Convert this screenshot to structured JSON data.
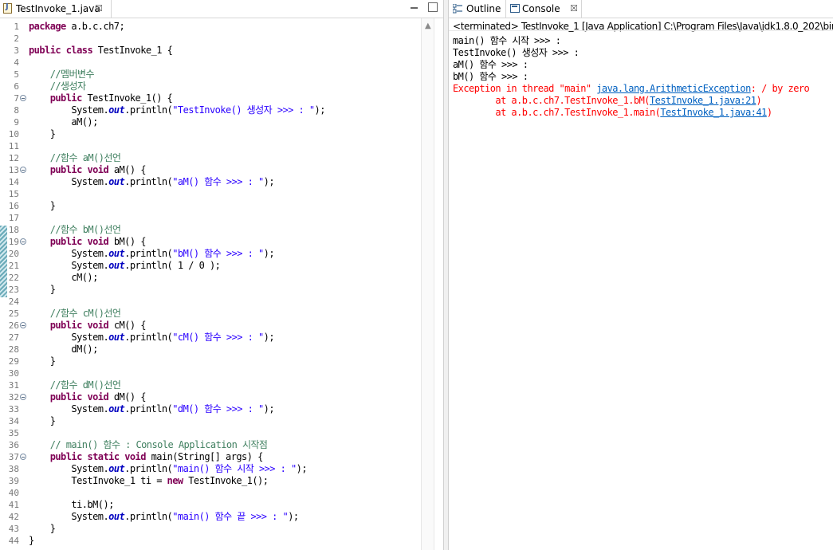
{
  "editor": {
    "tab_title": "TestInvoke_1.java",
    "tab_close": "☒",
    "file_icon_letter": "J",
    "lines": [
      {
        "n": "1",
        "fold": false,
        "segs": [
          {
            "c": "kw",
            "t": "package"
          },
          {
            "c": "",
            "t": " a.b.c.ch7;"
          }
        ]
      },
      {
        "n": "2",
        "fold": false,
        "segs": []
      },
      {
        "n": "3",
        "fold": false,
        "segs": [
          {
            "c": "kw",
            "t": "public"
          },
          {
            "c": "",
            "t": " "
          },
          {
            "c": "kw",
            "t": "class"
          },
          {
            "c": "",
            "t": " TestInvoke_1 {"
          }
        ]
      },
      {
        "n": "4",
        "fold": false,
        "segs": []
      },
      {
        "n": "5",
        "fold": false,
        "segs": [
          {
            "c": "",
            "t": "    "
          },
          {
            "c": "cm",
            "t": "//멤버변수"
          }
        ]
      },
      {
        "n": "6",
        "fold": false,
        "segs": [
          {
            "c": "",
            "t": "    "
          },
          {
            "c": "cm",
            "t": "//생성자"
          }
        ]
      },
      {
        "n": "7",
        "fold": true,
        "segs": [
          {
            "c": "",
            "t": "    "
          },
          {
            "c": "kw",
            "t": "public"
          },
          {
            "c": "",
            "t": " TestInvoke_1() {"
          }
        ]
      },
      {
        "n": "8",
        "fold": false,
        "segs": [
          {
            "c": "",
            "t": "        System."
          },
          {
            "c": "fld",
            "t": "out"
          },
          {
            "c": "",
            "t": ".println("
          },
          {
            "c": "str",
            "t": "\"TestInvoke() 생성자 >>> : \""
          },
          {
            "c": "",
            "t": ");"
          }
        ]
      },
      {
        "n": "9",
        "fold": false,
        "segs": [
          {
            "c": "",
            "t": "        aM();"
          }
        ]
      },
      {
        "n": "10",
        "fold": false,
        "segs": [
          {
            "c": "",
            "t": "    }"
          }
        ]
      },
      {
        "n": "11",
        "fold": false,
        "segs": []
      },
      {
        "n": "12",
        "fold": false,
        "segs": [
          {
            "c": "",
            "t": "    "
          },
          {
            "c": "cm",
            "t": "//함수 aM()선언"
          }
        ]
      },
      {
        "n": "13",
        "fold": true,
        "segs": [
          {
            "c": "",
            "t": "    "
          },
          {
            "c": "kw",
            "t": "public"
          },
          {
            "c": "",
            "t": " "
          },
          {
            "c": "kw",
            "t": "void"
          },
          {
            "c": "",
            "t": " aM() {"
          }
        ]
      },
      {
        "n": "14",
        "fold": false,
        "segs": [
          {
            "c": "",
            "t": "        System."
          },
          {
            "c": "fld",
            "t": "out"
          },
          {
            "c": "",
            "t": ".println("
          },
          {
            "c": "str",
            "t": "\"aM() 함수 >>> : \""
          },
          {
            "c": "",
            "t": ");"
          }
        ]
      },
      {
        "n": "15",
        "fold": false,
        "segs": []
      },
      {
        "n": "16",
        "fold": false,
        "segs": [
          {
            "c": "",
            "t": "    }"
          }
        ]
      },
      {
        "n": "17",
        "fold": false,
        "segs": []
      },
      {
        "n": "18",
        "fold": false,
        "segs": [
          {
            "c": "",
            "t": "    "
          },
          {
            "c": "cm",
            "t": "//함수 bM()선언"
          }
        ]
      },
      {
        "n": "19",
        "fold": true,
        "segs": [
          {
            "c": "",
            "t": "    "
          },
          {
            "c": "kw",
            "t": "public"
          },
          {
            "c": "",
            "t": " "
          },
          {
            "c": "kw",
            "t": "void"
          },
          {
            "c": "",
            "t": " bM() {"
          }
        ]
      },
      {
        "n": "20",
        "fold": false,
        "segs": [
          {
            "c": "",
            "t": "        System."
          },
          {
            "c": "fld",
            "t": "out"
          },
          {
            "c": "",
            "t": ".println("
          },
          {
            "c": "str",
            "t": "\"bM() 함수 >>> : \""
          },
          {
            "c": "",
            "t": ");"
          }
        ]
      },
      {
        "n": "21",
        "fold": false,
        "segs": [
          {
            "c": "",
            "t": "        System."
          },
          {
            "c": "fld",
            "t": "out"
          },
          {
            "c": "",
            "t": ".println( 1 / 0 );"
          }
        ]
      },
      {
        "n": "22",
        "fold": false,
        "segs": [
          {
            "c": "",
            "t": "        cM();"
          }
        ]
      },
      {
        "n": "23",
        "fold": false,
        "segs": [
          {
            "c": "",
            "t": "    }"
          }
        ]
      },
      {
        "n": "24",
        "fold": false,
        "segs": []
      },
      {
        "n": "25",
        "fold": false,
        "segs": [
          {
            "c": "",
            "t": "    "
          },
          {
            "c": "cm",
            "t": "//함수 cM()선언"
          }
        ]
      },
      {
        "n": "26",
        "fold": true,
        "segs": [
          {
            "c": "",
            "t": "    "
          },
          {
            "c": "kw",
            "t": "public"
          },
          {
            "c": "",
            "t": " "
          },
          {
            "c": "kw",
            "t": "void"
          },
          {
            "c": "",
            "t": " cM() {"
          }
        ]
      },
      {
        "n": "27",
        "fold": false,
        "segs": [
          {
            "c": "",
            "t": "        System."
          },
          {
            "c": "fld",
            "t": "out"
          },
          {
            "c": "",
            "t": ".println("
          },
          {
            "c": "str",
            "t": "\"cM() 함수 >>> : \""
          },
          {
            "c": "",
            "t": ");"
          }
        ]
      },
      {
        "n": "28",
        "fold": false,
        "segs": [
          {
            "c": "",
            "t": "        dM();"
          }
        ]
      },
      {
        "n": "29",
        "fold": false,
        "segs": [
          {
            "c": "",
            "t": "    }"
          }
        ]
      },
      {
        "n": "30",
        "fold": false,
        "segs": []
      },
      {
        "n": "31",
        "fold": false,
        "segs": [
          {
            "c": "",
            "t": "    "
          },
          {
            "c": "cm",
            "t": "//함수 dM()선언"
          }
        ]
      },
      {
        "n": "32",
        "fold": true,
        "segs": [
          {
            "c": "",
            "t": "    "
          },
          {
            "c": "kw",
            "t": "public"
          },
          {
            "c": "",
            "t": " "
          },
          {
            "c": "kw",
            "t": "void"
          },
          {
            "c": "",
            "t": " dM() {"
          }
        ]
      },
      {
        "n": "33",
        "fold": false,
        "segs": [
          {
            "c": "",
            "t": "        System."
          },
          {
            "c": "fld",
            "t": "out"
          },
          {
            "c": "",
            "t": ".println("
          },
          {
            "c": "str",
            "t": "\"dM() 함수 >>> : \""
          },
          {
            "c": "",
            "t": ");"
          }
        ]
      },
      {
        "n": "34",
        "fold": false,
        "segs": [
          {
            "c": "",
            "t": "    }"
          }
        ]
      },
      {
        "n": "35",
        "fold": false,
        "segs": []
      },
      {
        "n": "36",
        "fold": false,
        "segs": [
          {
            "c": "",
            "t": "    "
          },
          {
            "c": "cm",
            "t": "// main() 함수 : Console Application 시작점"
          }
        ]
      },
      {
        "n": "37",
        "fold": true,
        "segs": [
          {
            "c": "",
            "t": "    "
          },
          {
            "c": "kw",
            "t": "public"
          },
          {
            "c": "",
            "t": " "
          },
          {
            "c": "kw",
            "t": "static"
          },
          {
            "c": "",
            "t": " "
          },
          {
            "c": "kw",
            "t": "void"
          },
          {
            "c": "",
            "t": " main(String[] args) {"
          }
        ]
      },
      {
        "n": "38",
        "fold": false,
        "segs": [
          {
            "c": "",
            "t": "        System."
          },
          {
            "c": "fld",
            "t": "out"
          },
          {
            "c": "",
            "t": ".println("
          },
          {
            "c": "str",
            "t": "\"main() 함수 시작 >>> : \""
          },
          {
            "c": "",
            "t": ");"
          }
        ]
      },
      {
        "n": "39",
        "fold": false,
        "segs": [
          {
            "c": "",
            "t": "        TestInvoke_1 ti = "
          },
          {
            "c": "kw",
            "t": "new"
          },
          {
            "c": "",
            "t": " TestInvoke_1();"
          }
        ]
      },
      {
        "n": "40",
        "fold": false,
        "segs": []
      },
      {
        "n": "41",
        "fold": false,
        "segs": [
          {
            "c": "",
            "t": "        ti.bM();"
          }
        ]
      },
      {
        "n": "42",
        "fold": false,
        "segs": [
          {
            "c": "",
            "t": "        System."
          },
          {
            "c": "fld",
            "t": "out"
          },
          {
            "c": "",
            "t": ".println("
          },
          {
            "c": "str",
            "t": "\"main() 함수 끝 >>> : \""
          },
          {
            "c": "",
            "t": ");"
          }
        ]
      },
      {
        "n": "43",
        "fold": false,
        "segs": [
          {
            "c": "",
            "t": "    }"
          }
        ]
      },
      {
        "n": "44",
        "fold": false,
        "segs": [
          {
            "c": "",
            "t": "}"
          }
        ]
      }
    ]
  },
  "views": {
    "outline_label": "Outline",
    "console_label": "Console",
    "console_close": "☒"
  },
  "console": {
    "status": "<terminated> TestInvoke_1 [Java Application] C:\\Program Files\\Java\\jdk1.8.0_202\\bin\\",
    "lines": [
      {
        "segs": [
          {
            "c": "",
            "t": "main() 함수 시작 >>> :"
          }
        ]
      },
      {
        "segs": [
          {
            "c": "",
            "t": "TestInvoke() 생성자 >>> :"
          }
        ]
      },
      {
        "segs": [
          {
            "c": "",
            "t": "aM() 함수 >>> :"
          }
        ]
      },
      {
        "segs": [
          {
            "c": "",
            "t": "bM() 함수 >>> :"
          }
        ]
      },
      {
        "segs": [
          {
            "c": "err",
            "t": "Exception in thread \"main\" "
          },
          {
            "c": "link",
            "t": "java.lang.ArithmeticException"
          },
          {
            "c": "err",
            "t": ": / by zero"
          }
        ]
      },
      {
        "segs": [
          {
            "c": "err",
            "t": "        at a.b.c.ch7.TestInvoke_1.bM("
          },
          {
            "c": "link",
            "t": "TestInvoke_1.java:21"
          },
          {
            "c": "err",
            "t": ")"
          }
        ]
      },
      {
        "segs": [
          {
            "c": "err",
            "t": "        at a.b.c.ch7.TestInvoke_1.main("
          },
          {
            "c": "link",
            "t": "TestInvoke_1.java:41"
          },
          {
            "c": "err",
            "t": ")"
          }
        ]
      }
    ]
  },
  "colors": {
    "keyword": "#7f0055",
    "comment": "#3f7f5f",
    "string": "#2a00ff",
    "field": "#0000c0",
    "error": "#ff0000",
    "link": "#0060c0"
  }
}
